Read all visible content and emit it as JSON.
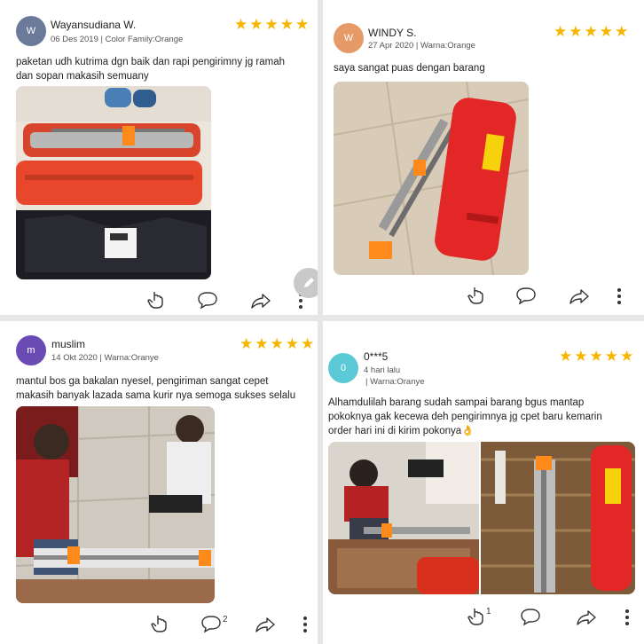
{
  "reviews": [
    {
      "name": "Wayansudiana W.",
      "meta": "06 Des 2019 | Color Family:Orange",
      "avatar_letter": "W",
      "avatar_color": "#6c7a99",
      "stars": "★★★★★",
      "text": [
        "paketan udh kutrima dgn baik dan rapi pengirimny jg ramah",
        "dan sopan makasih semuany"
      ]
    },
    {
      "name": "WINDY S.",
      "meta": "27 Apr 2020 | Warna:Orange",
      "avatar_letter": "W",
      "avatar_color": "#e69a67",
      "stars": "★★★★★",
      "text": [
        "saya sangat puas dengan barang"
      ]
    },
    {
      "name": "muslim",
      "meta": "14 Okt 2020 | Warna:Oranye",
      "avatar_letter": "m",
      "avatar_color": "#6a4bb3",
      "stars": "★★★★★",
      "text": [
        "mantul bos ga bakalan nyesel, pengiriman sangat cepet",
        "makasih banyak lazada sama kurir nya semoga sukses selalu"
      ],
      "comment_count": "2"
    },
    {
      "name": "0***5",
      "meta_line1": "4  hari lalu",
      "meta_line2": "| Warna:Oranye",
      "avatar_letter": "0",
      "avatar_color": "#5ccad6",
      "stars": "★★★★★",
      "text": [
        "Alhamdulilah barang sudah sampai barang bgus mantap",
        "pokoknya gak kecewa deh pengirimnya jg cpet baru kemarin",
        "order hari ini di kirim pokonya👌"
      ],
      "like_count": "1"
    }
  ],
  "colors": {
    "star": "#f7b500",
    "product": "#e8472b",
    "handle": "#ff8a1c"
  },
  "icons": [
    "like-hand-icon",
    "comment-icon",
    "share-icon",
    "more-icon",
    "edit-icon"
  ]
}
